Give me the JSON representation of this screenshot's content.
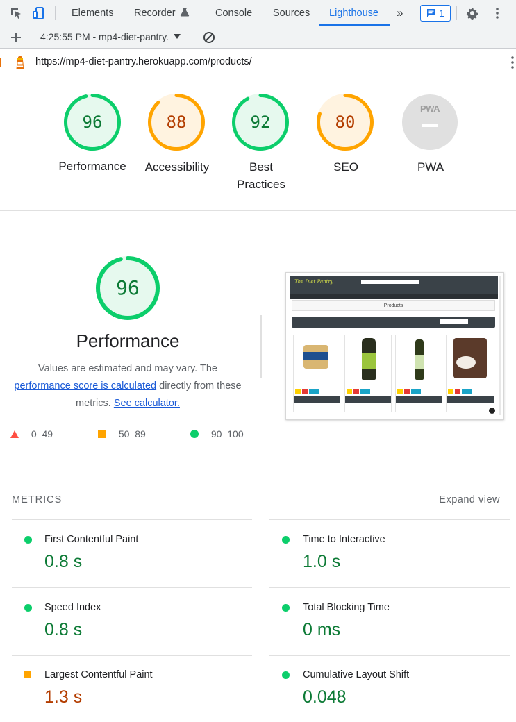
{
  "devtools": {
    "tabs": [
      "Elements",
      "Recorder",
      "Console",
      "Sources",
      "Lighthouse"
    ],
    "active_tab": "Lighthouse",
    "issues_count": "1",
    "report_label": "4:25:55 PM - mp4-diet-pantry.",
    "url": "https://mp4-diet-pantry.herokuapp.com/products/"
  },
  "gauges": [
    {
      "score": "96",
      "label": "Performance",
      "color": "#0cce6b",
      "text_color": "#0c7a35",
      "bg": "#e6f9ee",
      "fraction": 0.96
    },
    {
      "score": "88",
      "label": "Accessibility",
      "color": "#ffa400",
      "text_color": "#b33d00",
      "bg": "#fff3e0",
      "fraction": 0.88
    },
    {
      "score": "92",
      "label_line1": "Best",
      "label_line2": "Practices",
      "color": "#0cce6b",
      "text_color": "#0c7a35",
      "bg": "#e6f9ee",
      "fraction": 0.92
    },
    {
      "score": "80",
      "label": "SEO",
      "color": "#ffa400",
      "text_color": "#b33d00",
      "bg": "#fff3e0",
      "fraction": 0.8
    },
    {
      "badge": "PWA",
      "label": "PWA"
    }
  ],
  "performance": {
    "score": "96",
    "fraction": 0.96,
    "title": "Performance",
    "desc_part1": "Values are estimated and may vary. The",
    "desc_link1": "performance score is calculated",
    "desc_part2": "directly from these metrics.",
    "desc_link2": "See calculator."
  },
  "legend": [
    {
      "range": "0–49",
      "color": "#ff4e42",
      "shape": "triangle"
    },
    {
      "range": "50–89",
      "color": "#ffa400",
      "shape": "square"
    },
    {
      "range": "90–100",
      "color": "#0cce6b",
      "shape": "circle"
    }
  ],
  "metrics": {
    "heading": "METRICS",
    "expand_label": "Expand view",
    "items": [
      {
        "name": "First Contentful Paint",
        "value": "0.8 s",
        "status": "good"
      },
      {
        "name": "Time to Interactive",
        "value": "1.0 s",
        "status": "good"
      },
      {
        "name": "Speed Index",
        "value": "0.8 s",
        "status": "good"
      },
      {
        "name": "Total Blocking Time",
        "value": "0 ms",
        "status": "good"
      },
      {
        "name": "Largest Contentful Paint",
        "value": "1.3 s",
        "status": "average"
      },
      {
        "name": "Cumulative Layout Shift",
        "value": "0.048",
        "status": "good"
      }
    ]
  },
  "thumbnail": {
    "brand": "The Diet Pantry",
    "page_heading": "Products"
  }
}
